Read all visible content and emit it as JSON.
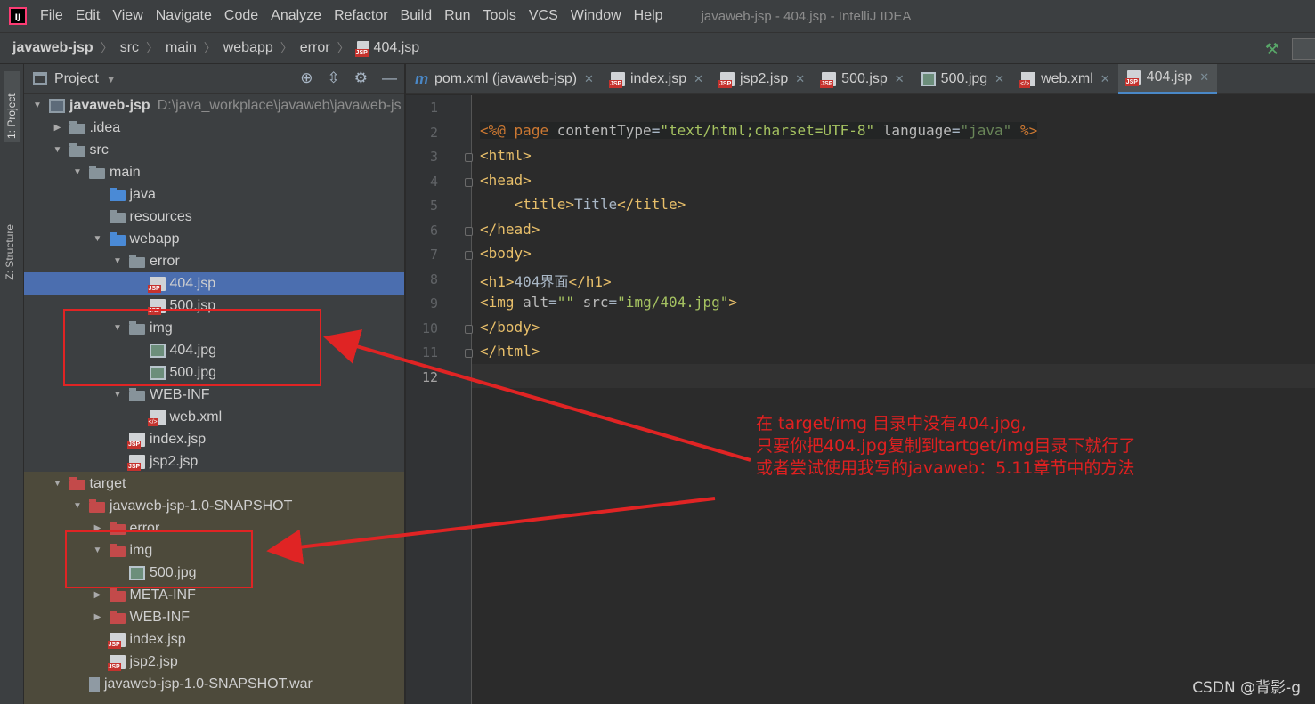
{
  "menu": {
    "items": [
      "File",
      "Edit",
      "View",
      "Navigate",
      "Code",
      "Analyze",
      "Refactor",
      "Build",
      "Run",
      "Tools",
      "VCS",
      "Window",
      "Help"
    ],
    "window_title": "javaweb-jsp - 404.jsp - IntelliJ IDEA"
  },
  "breadcrumb": [
    "javaweb-jsp",
    "src",
    "main",
    "webapp",
    "error",
    "404.jsp"
  ],
  "toolstrip": {
    "project_tab": "1: Project",
    "structure_tab": "Z: Structure"
  },
  "project_panel": {
    "title": "Project",
    "tree": [
      {
        "label": "javaweb-jsp",
        "path": "D:\\java_workplace\\javaweb\\javaweb-js",
        "depth": 0,
        "arrow": "down",
        "icon": "module",
        "bold": true
      },
      {
        "label": ".idea",
        "depth": 1,
        "arrow": "right",
        "icon": "folder"
      },
      {
        "label": "src",
        "depth": 1,
        "arrow": "down",
        "icon": "folder"
      },
      {
        "label": "main",
        "depth": 2,
        "arrow": "down",
        "icon": "folder"
      },
      {
        "label": "java",
        "depth": 3,
        "arrow": "",
        "icon": "folder-blue"
      },
      {
        "label": "resources",
        "depth": 3,
        "arrow": "",
        "icon": "folder-res"
      },
      {
        "label": "webapp",
        "depth": 3,
        "arrow": "down",
        "icon": "folder-web"
      },
      {
        "label": "error",
        "depth": 4,
        "arrow": "down",
        "icon": "folder"
      },
      {
        "label": "404.jsp",
        "depth": 5,
        "arrow": "",
        "icon": "jsp",
        "selected": true
      },
      {
        "label": "500.jsp",
        "depth": 5,
        "arrow": "",
        "icon": "jsp"
      },
      {
        "label": "img",
        "depth": 4,
        "arrow": "down",
        "icon": "folder"
      },
      {
        "label": "404.jpg",
        "depth": 5,
        "arrow": "",
        "icon": "jpg"
      },
      {
        "label": "500.jpg",
        "depth": 5,
        "arrow": "",
        "icon": "jpg"
      },
      {
        "label": "WEB-INF",
        "depth": 4,
        "arrow": "down",
        "icon": "folder"
      },
      {
        "label": "web.xml",
        "depth": 5,
        "arrow": "",
        "icon": "xml"
      },
      {
        "label": "index.jsp",
        "depth": 4,
        "arrow": "",
        "icon": "jsp"
      },
      {
        "label": "jsp2.jsp",
        "depth": 4,
        "arrow": "",
        "icon": "jsp"
      },
      {
        "label": "target",
        "depth": 1,
        "arrow": "down",
        "icon": "folder-red"
      },
      {
        "label": "javaweb-jsp-1.0-SNAPSHOT",
        "depth": 2,
        "arrow": "down",
        "icon": "folder-red"
      },
      {
        "label": "error",
        "depth": 3,
        "arrow": "right",
        "icon": "folder-red"
      },
      {
        "label": "img",
        "depth": 3,
        "arrow": "down",
        "icon": "folder-red"
      },
      {
        "label": "500.jpg",
        "depth": 4,
        "arrow": "",
        "icon": "jpg"
      },
      {
        "label": "META-INF",
        "depth": 3,
        "arrow": "right",
        "icon": "folder-red"
      },
      {
        "label": "WEB-INF",
        "depth": 3,
        "arrow": "right",
        "icon": "folder-red"
      },
      {
        "label": "index.jsp",
        "depth": 3,
        "arrow": "",
        "icon": "jsp"
      },
      {
        "label": "jsp2.jsp",
        "depth": 3,
        "arrow": "",
        "icon": "jsp"
      },
      {
        "label": "javaweb-jsp-1.0-SNAPSHOT.war",
        "depth": 2,
        "arrow": "",
        "icon": "war"
      }
    ]
  },
  "tabs": [
    {
      "label": "pom.xml (javaweb-jsp)",
      "icon": "maven"
    },
    {
      "label": "index.jsp",
      "icon": "jsp"
    },
    {
      "label": "jsp2.jsp",
      "icon": "jsp"
    },
    {
      "label": "500.jsp",
      "icon": "jsp"
    },
    {
      "label": "500.jpg",
      "icon": "jpg"
    },
    {
      "label": "web.xml",
      "icon": "xml"
    },
    {
      "label": "404.jsp",
      "icon": "jsp",
      "active": true
    }
  ],
  "editor": {
    "line_numbers": [
      "1",
      "2",
      "3",
      "4",
      "5",
      "6",
      "7",
      "8",
      "9",
      "10",
      "11",
      "12"
    ],
    "current_line": "12"
  },
  "annotation": {
    "line1": "在 target/img 目录中没有404.jpg,",
    "line2": "只要你把404.jpg复制到tartget/img目录下就行了",
    "line3": "或者尝试使用我写的javaweb：5.11章节中的方法"
  },
  "watermark": "CSDN @背影-g",
  "colors": {
    "accent": "#4a88c7",
    "selection": "#4b6eaf",
    "annotation_red": "#e02020",
    "target_bg": "#4d4a3b"
  }
}
